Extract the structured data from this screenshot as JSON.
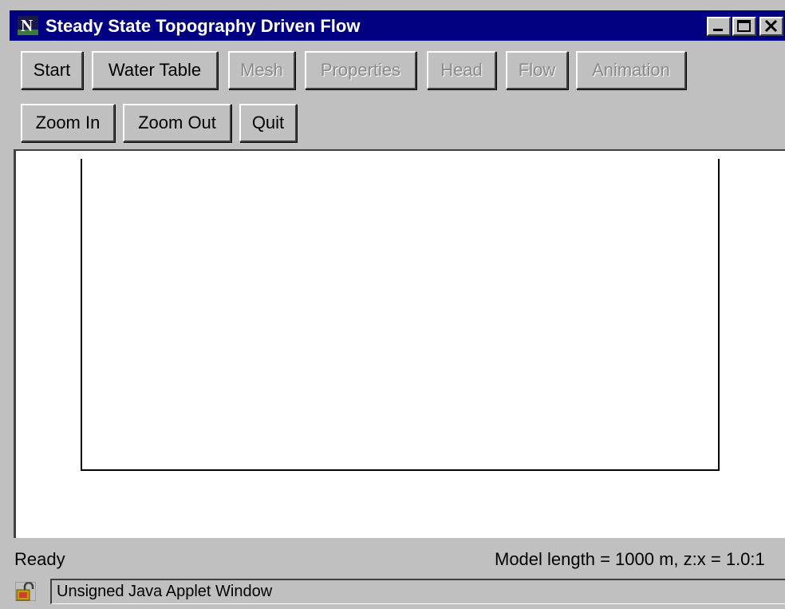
{
  "window": {
    "title": "Steady State Topography Driven Flow"
  },
  "toolbar": {
    "row1": [
      {
        "label": "Start",
        "enabled": true
      },
      {
        "label": "Water Table",
        "enabled": true
      },
      {
        "label": "Mesh",
        "enabled": false
      },
      {
        "label": "Properties",
        "enabled": false
      },
      {
        "label": "Head",
        "enabled": false
      },
      {
        "label": "Flow",
        "enabled": false
      },
      {
        "label": "Animation",
        "enabled": false
      }
    ],
    "row2": [
      {
        "label": "Zoom In",
        "enabled": true
      },
      {
        "label": "Zoom Out",
        "enabled": true
      },
      {
        "label": "Quit",
        "enabled": true
      }
    ]
  },
  "status": {
    "left": "Ready",
    "right": "Model length = 1000 m, z:x = 1.0:1"
  },
  "applet_bar": {
    "text": "Unsigned Java Applet Window",
    "icon": "unlocked-padlock-icon"
  },
  "colors": {
    "titlebar": "#000080",
    "face": "#c0c0c0",
    "disabled_text": "#8a8a8a",
    "canvas": "#ffffff"
  }
}
